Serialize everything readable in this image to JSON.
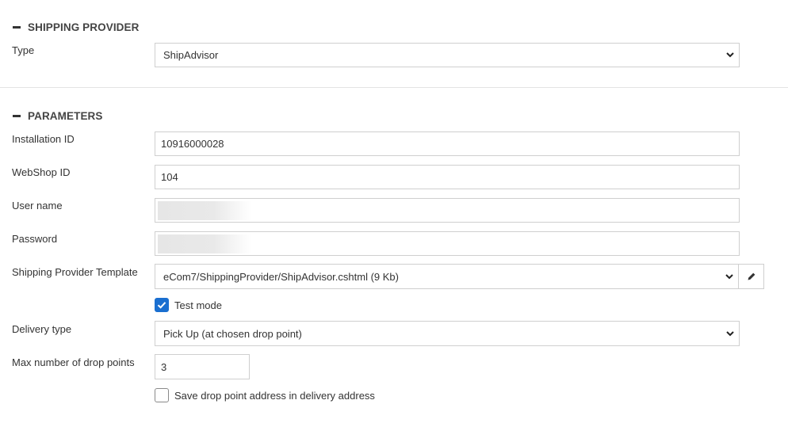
{
  "shipping_provider": {
    "title": "SHIPPING PROVIDER",
    "type_label": "Type",
    "type_value": "ShipAdvisor"
  },
  "parameters": {
    "title": "PARAMETERS",
    "installation_id_label": "Installation ID",
    "installation_id_value": "10916000028",
    "webshop_id_label": "WebShop ID",
    "webshop_id_value": "104",
    "username_label": "User name",
    "password_label": "Password",
    "template_label": "Shipping Provider Template",
    "template_value": "eCom7/ShippingProvider/ShipAdvisor.cshtml (9 Kb)",
    "test_mode_label": "Test mode",
    "test_mode_checked": true,
    "delivery_type_label": "Delivery type",
    "delivery_type_value": "Pick Up (at chosen drop point)",
    "max_drop_points_label": "Max number of drop points",
    "max_drop_points_value": "3",
    "save_address_label": "Save drop point address in delivery address",
    "save_address_checked": false
  },
  "colors": {
    "checkbox_accent": "#1a6fd0",
    "border": "#cfcfcf",
    "divider": "#e3e3e3"
  },
  "icons": [
    "collapse-dash-icon",
    "chevron-down-icon",
    "pencil-icon",
    "checkmark-icon"
  ]
}
